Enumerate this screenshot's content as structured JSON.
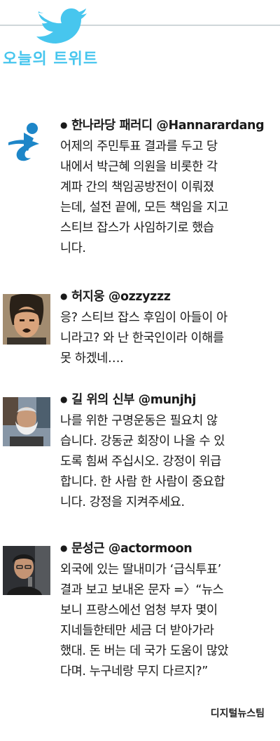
{
  "section": {
    "title": "오늘의 트위트",
    "bird_icon": "twitter-bird-icon",
    "accent": "#47c6ee"
  },
  "tweets": [
    {
      "author": "한나라당 패러디 @Hannarardang",
      "avatar": "hannara-party-logo",
      "lines": [
        "어제의 주민투표 결과를 두고 당",
        "내에서 박근혜 의원을 비롯한 각",
        "계파 간의 책임공방전이 이뤄졌",
        "는데, 설전 끝에, 모든 책임을 지고",
        "스티브 잡스가 사임하기로 했습",
        "니다."
      ]
    },
    {
      "author": "허지웅 @ozzyzzz",
      "avatar": "profile-photo-man",
      "lines": [
        "응? 스티브 잡스 후임이 아들이 아",
        "니라고? 와 난 한국인이라 이해를",
        "못 하겠네…."
      ]
    },
    {
      "author": "길 위의 신부 @munjhj",
      "avatar": "profile-photo-priest",
      "lines": [
        "나를 위한 구명운동은 필요치 않",
        "습니다. 강동균 회장이 나올 수 있",
        "도록 힘써 주십시오. 강정이 위급",
        "합니다. 한 사람 한 사람이 중요합",
        "니다. 강정을 지켜주세요."
      ]
    },
    {
      "author": "문성근 @actormoon",
      "avatar": "profile-photo-actor",
      "lines": [
        "외국에 있는 딸내미가 ‘급식투표’",
        "결과 보고 보내온 문자 =〉“뉴스",
        "보니 프랑스에선 엄청 부자 몇이",
        "지네들한테만 세금 더 받아가라",
        "했대. 돈 버는 데 국가 도움이 많았",
        "다며. 누구네랑 무지 다르지?”"
      ]
    }
  ],
  "credit": "디지털뉴스팀"
}
